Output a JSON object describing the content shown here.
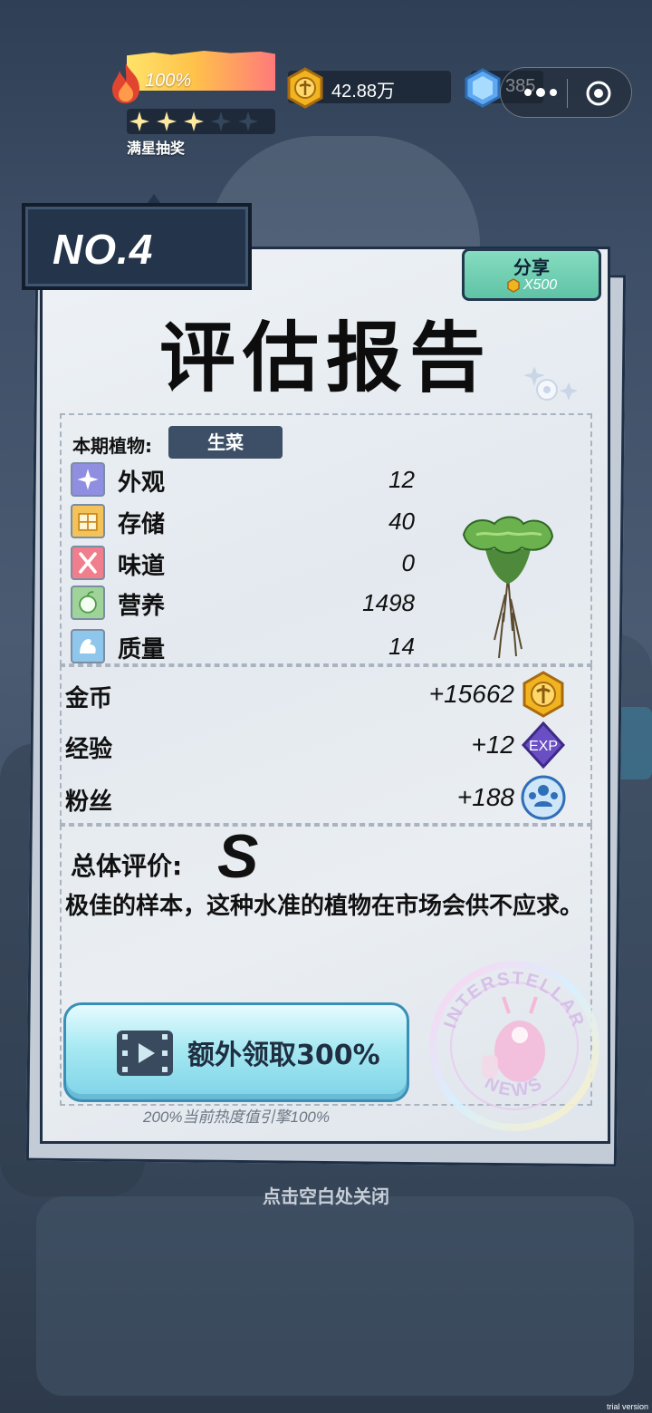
{
  "hud": {
    "heat_percent": "100%",
    "heat_value": 1.0,
    "stars_filled": 3,
    "stars_total": 5,
    "star_label": "满星抽奖",
    "coins": "42.88万",
    "gems": "385"
  },
  "report": {
    "number_tag": "NO.4",
    "share_label": "分享",
    "share_reward": "X500",
    "title": "评估报告",
    "plant_label": "本期植物:",
    "plant_name": "生菜",
    "stats": [
      {
        "name": "外观",
        "value": "12",
        "icon": "sparkle-icon",
        "color": "#8f8ee0"
      },
      {
        "name": "存储",
        "value": "40",
        "icon": "crate-icon",
        "color": "#f3c35a"
      },
      {
        "name": "味道",
        "value": "0",
        "icon": "utensils-icon",
        "color": "#f07e8c"
      },
      {
        "name": "营养",
        "value": "1498",
        "icon": "nutrition-icon",
        "color": "#9fd39a"
      },
      {
        "name": "质量",
        "value": "14",
        "icon": "muscle-icon",
        "color": "#8fc6ec"
      }
    ],
    "rewards": [
      {
        "name": "金币",
        "value": "+15662",
        "icon": "coin-icon"
      },
      {
        "name": "经验",
        "value": "+12",
        "icon": "exp-icon"
      },
      {
        "name": "粉丝",
        "value": "+188",
        "icon": "fans-icon"
      }
    ],
    "exp_badge": "EXP",
    "overall_label": "总体评价:",
    "grade": "S",
    "comment": "极佳的样本，这种水准的植物在市场会供不应求。",
    "extra_button": "额外领取300%",
    "extra_note": "200%当前热度值引擎100%",
    "stamp_top": "INTERSTELLAR",
    "stamp_bottom": "NEWS"
  },
  "close_tip": "点击空白处关闭",
  "watermark": "trial version",
  "colors": {
    "navy": "#1f3046",
    "share_green": "#5fc3a6",
    "button_cyan": "#7dd3e8",
    "coin_gold": "#f0b420",
    "exp_purple": "#6a4fc4",
    "fans_blue": "#2f6fb8"
  }
}
